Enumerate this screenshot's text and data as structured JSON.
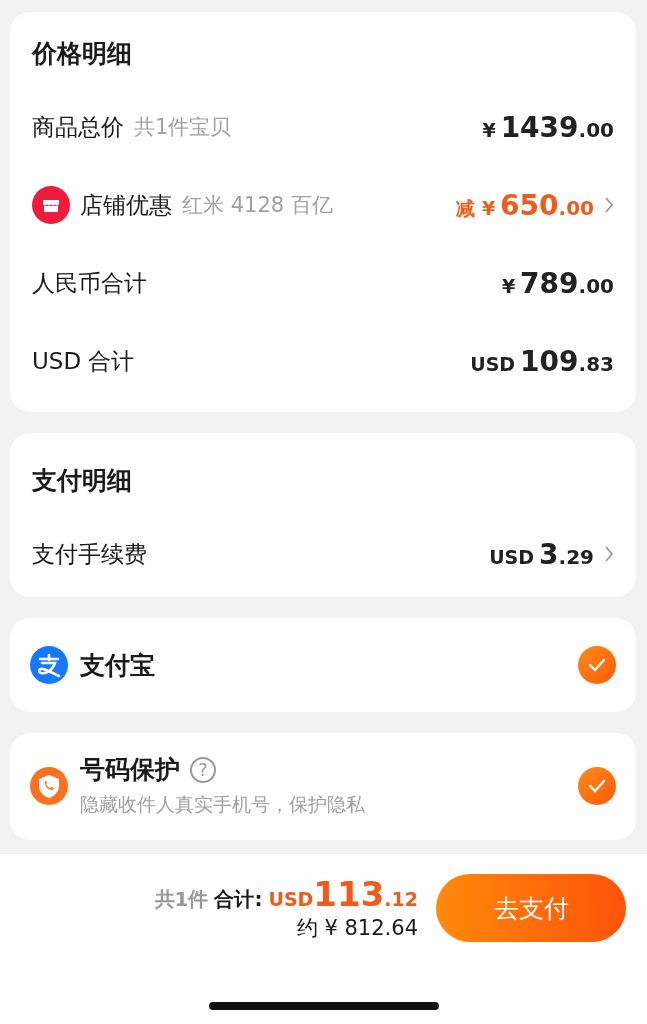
{
  "price_card": {
    "title": "价格明细",
    "rows": [
      {
        "kind": "plain",
        "label": "商品总价",
        "note": "共1件宝贝",
        "prefix": "¥",
        "whole": "1439",
        "cents": ".00",
        "discount": false,
        "link": false
      },
      {
        "kind": "shop",
        "label": "店铺优惠",
        "note": "红米 4128 百亿",
        "prefix": "减 ¥",
        "whole": "650",
        "cents": ".00",
        "discount": true,
        "link": true
      },
      {
        "kind": "plain",
        "label": "人民币合计",
        "prefix": "¥",
        "whole": "789",
        "cents": ".00",
        "discount": false,
        "link": false
      },
      {
        "kind": "plain",
        "label": "USD 合计",
        "prefix": "USD",
        "whole": "109",
        "cents": ".83",
        "discount": false,
        "link": false
      }
    ]
  },
  "payment_card": {
    "title": "支付明细",
    "rows": [
      {
        "label": "支付手续费",
        "prefix": "USD",
        "whole": "3",
        "cents": ".29",
        "discount": false,
        "link": true
      }
    ]
  },
  "options": [
    {
      "kind": "alipay",
      "label": "支付宝",
      "checked": true
    },
    {
      "kind": "phone",
      "label": "号码保护",
      "help": "?",
      "description": "隐藏收件人真实手机号，保护隐私",
      "checked": true
    }
  ],
  "footer": {
    "count": "共1件",
    "total_label": "合计:",
    "currency": "USD",
    "whole": "113",
    "cents": ".12",
    "approx": "约 ¥ 812.64",
    "pay_button": "去支付"
  }
}
